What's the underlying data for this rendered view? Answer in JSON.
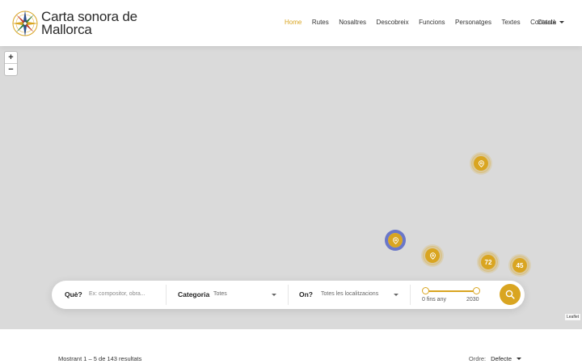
{
  "brand": {
    "line1": "Carta sonora de",
    "line2": "Mallorca",
    "accent": "#d9a521"
  },
  "nav": {
    "items": [
      {
        "label": "Home",
        "active": true
      },
      {
        "label": "Rutes"
      },
      {
        "label": "Nosaltres"
      },
      {
        "label": "Descobreix"
      },
      {
        "label": "Funcions"
      },
      {
        "label": "Personatges"
      },
      {
        "label": "Textes"
      },
      {
        "label": "Contacte"
      }
    ],
    "language": "Català"
  },
  "map": {
    "zoom_in": "+",
    "zoom_out": "−",
    "attribution": "Leaflet",
    "markers": [
      {
        "icon": "location-pin-icon",
        "label": ""
      },
      {
        "icon": "location-pin-icon",
        "label": "",
        "selected": true
      },
      {
        "icon": "location-pin-icon",
        "label": ""
      },
      {
        "icon": "",
        "label": "72"
      },
      {
        "icon": "",
        "label": "45"
      }
    ]
  },
  "search": {
    "what_label": "Què?",
    "what_placeholder": "Ex: compositor, obra...",
    "category_label": "Categoria",
    "category_value": "Totes",
    "where_label": "On?",
    "where_value": "Totes les localitzacions",
    "range_min": "0 fins any",
    "range_max": "2030",
    "search_icon": "search-icon"
  },
  "results": {
    "summary": "Mostrant 1 – 5 de 143 resultats",
    "order_label": "Ordre:",
    "order_value": "Defecte"
  }
}
